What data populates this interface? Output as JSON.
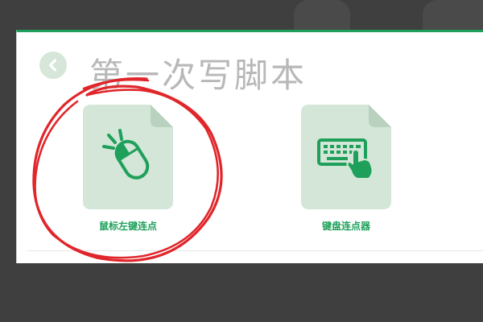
{
  "window": {
    "title": "第一次写脚本"
  },
  "options": [
    {
      "label": "鼠标左键连点",
      "icon": "mouse-click-icon"
    },
    {
      "label": "键盘连点器",
      "icon": "keyboard-press-icon"
    }
  ],
  "colors": {
    "accent": "#1fa05a",
    "card_bg": "#d3e6d8",
    "title": "#b8b8b8",
    "annotation": "#e0262b",
    "background": "#3f3f3f"
  }
}
